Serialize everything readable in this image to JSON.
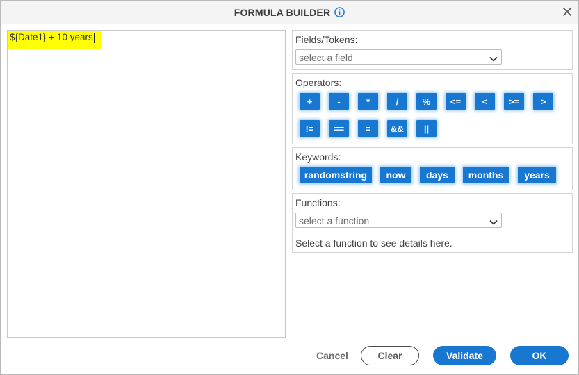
{
  "dialog": {
    "title": "FORMULA BUILDER",
    "info_icon": "info-circle-icon",
    "close_icon": "close-icon"
  },
  "editor": {
    "text": "${Date1} + 10 years",
    "highlight_color": "#ffff00"
  },
  "fields": {
    "label": "Fields/Tokens:",
    "select_value": "select a field"
  },
  "operators": {
    "label": "Operators:",
    "items": [
      "+",
      "-",
      "*",
      "/",
      "%",
      "<=",
      "<",
      ">=",
      ">",
      "!=",
      "==",
      "=",
      "&&",
      "||"
    ]
  },
  "keywords": {
    "label": "Keywords:",
    "items": [
      "randomstring",
      "now",
      "days",
      "months",
      "years"
    ]
  },
  "functions": {
    "label": "Functions:",
    "select_value": "select a function",
    "description": "Select a function to see details here."
  },
  "footer": {
    "cancel": "Cancel",
    "clear": "Clear",
    "validate": "Validate",
    "ok": "OK"
  },
  "colors": {
    "accent": "#1878d1"
  }
}
